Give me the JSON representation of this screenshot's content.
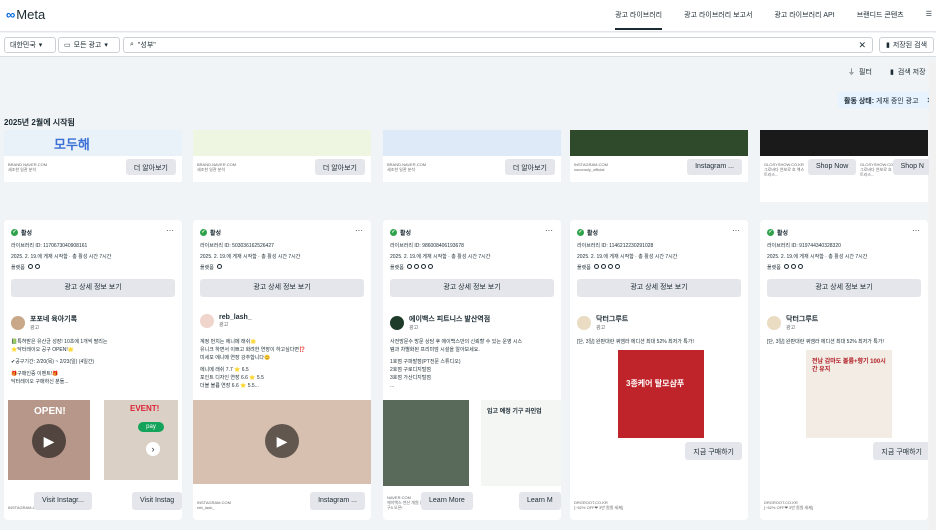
{
  "header": {
    "logo": "Meta",
    "nav": [
      "광고 라이브러리",
      "광고 라이브러리 보고서",
      "광고 라이브러리 API",
      "브랜디드 콘텐츠"
    ],
    "nav_more": "☰"
  },
  "filters": {
    "country": "대한민국",
    "ad_type": "모든 광고",
    "search_value": "\"성부\"",
    "saved_search_label": "저장된 검색"
  },
  "tools": {
    "filter_label": "필터",
    "save_search_label": "검색 저장"
  },
  "active_filter": {
    "label": "활동 상태:",
    "value": "게재 중인 광고"
  },
  "section_title": "2025년 2월에 시작됨",
  "top_row": [
    {
      "source": "BRAND.NAVER.COM",
      "sub": "세조한 일관 분석",
      "cta": "더 알아보기",
      "thumb_text": "모두해"
    },
    {
      "source": "BRAND.NAVER.COM",
      "sub": "세조한 일관 분석",
      "cta": "더 알아보기",
      "thumb_text": ""
    },
    {
      "source": "BRAND.NAVER.COM",
      "sub": "세조한 일관 분석",
      "cta": "더 알아보기",
      "thumb_text": ""
    },
    {
      "source": "INSTAGRAM.COM",
      "sub": "cocomoly_official",
      "cta": "Instagram ...",
      "thumb_text": ""
    },
    {
      "source": "GLOSYSHOW.CO.KR",
      "sub": "그로바다 연보로 흐 액스트라스...",
      "cta": "Shop Now",
      "thumb_text": ""
    },
    {
      "source": "GLOSYSHOW.CO.KR",
      "sub": "그로바다 연보로 흐 액스트라스...",
      "cta": "Shop N",
      "thumb_text": ""
    }
  ],
  "cards": [
    {
      "status": "활성",
      "library_id": "라이브러리 ID: 1170673040908161",
      "started": "2025. 2. 19.에 게재 시작함 · 총 활성 시간 7시간",
      "platforms_label": "플랫폼",
      "detail_btn": "광고 상세 정보 보기",
      "advertiser": "포포네 육아기록",
      "advertiser_sub": "광고",
      "body": [
        "📗특허받은 유산균 성장! 10초에 1개씩 팔리는",
        "⭐닥터레이오 공구 OPEN!🌟",
        "",
        "✔공구기간: 2/20(목) ~ 2/23(일) (4일간)",
        "",
        "🎁구매인증 이벤트!🎁",
        "닥터레이오 구매하신 분들..."
      ],
      "media_labels": [
        "OPEN!",
        "EVENT!"
      ],
      "source": "INSTAGRAM.COM",
      "cta": "Visit Instagr...",
      "cta2": "Visit Instag"
    },
    {
      "status": "활성",
      "library_id": "라이브러리 ID: 503036162526427",
      "started": "2025. 2. 19.에 게재 시작함 · 총 활성 시간 7시간",
      "platforms_label": "플랫폼",
      "detail_btn": "광고 상세 정보 보기",
      "advertiser": "reb_lash_",
      "advertiser_sub": "광고",
      "body": [
        "계정 번치는 에니메 래쉬🌟",
        "유니크 하면서 이쁘고 화려한 연장이 하고싶다면⁉️",
        "미세모 에니메 연장 강추합니다😊",
        "",
        "에니메 래쉬 7.7 ⭐ 6.5",
        "포인트 디자인 연장 6.6 ⭐ 5.5",
        "더블 볼륨 연장 6.6 ⭐ 5.5..."
      ],
      "media_labels": [],
      "source": "INSTAGRAM.COM",
      "sub_src": "reb_lash_",
      "cta": "Instagram ..."
    },
    {
      "status": "활성",
      "library_id": "라이브러리 ID: 986008406193678",
      "started": "2025. 2. 19.에 게재 시작함 · 총 활성 시간 7시간",
      "platforms_label": "플랫폼",
      "detail_btn": "광고 상세 정보 보기",
      "advertiser": "에이백스 피트니스 발산역점",
      "advertiser_sub": "광고",
      "body": [
        "사전방문수 방문 상담 후 에이백스만의 신뢰할 수 있는 운영 시스",
        "템과 차별화된 프리미엄 시설을 알아보세요.",
        "",
        "1호점 구파발점(PT전문 스튜디오)",
        "2호점 구로디지털점",
        "3호점 가산디지털점",
        "..."
      ],
      "media_labels": [
        "입고 예정 기구 라인업"
      ],
      "source": "NAVER.COM",
      "sub_src": "에이백스 연산 개원 입구5 오픈!",
      "cta": "Learn More",
      "cta2": "Learn M"
    },
    {
      "status": "활성",
      "library_id": "라이브러리 ID: 1146212230291028",
      "started": "2025. 2. 19.에 게재 시작함 · 총 활성 시간 7시간",
      "platforms_label": "플랫폼",
      "detail_btn": "광고 상세 정보 보기",
      "advertiser": "닥터그루트",
      "advertiser_sub": "광고",
      "body": [
        "[단, 3일] 완판대란 쿼엠라 에디션 최대 52% 최저가 특가!"
      ],
      "media_labels": [
        "3종케어 탈모샴푸"
      ],
      "source": "DRGROOT.CO.KR",
      "sub_src": "[~52% OFF❤ 3만 원원 세제]",
      "cta": "지금 구매하기"
    },
    {
      "status": "활성",
      "library_id": "라이브러리 ID: 919744340328320",
      "started": "2025. 2. 19.에 게재 시작함 · 총 활성 시간 7시간",
      "platforms_label": "플랫폼",
      "detail_btn": "광고 상세 정보 보기",
      "advertiser": "닥터그루트",
      "advertiser_sub": "광고",
      "body": [
        "[단, 3일] 완판대란 쿼엠라 에디션 최대 52% 최저가 특가!"
      ],
      "media_labels": [
        "전남 감마도 볼륨+향기 100시간 유지"
      ],
      "source": "DRGROOT.CO.KR",
      "sub_src": "[~52% OFF❤ 3만 원원 세제]",
      "cta": "지금 구매하기"
    }
  ]
}
